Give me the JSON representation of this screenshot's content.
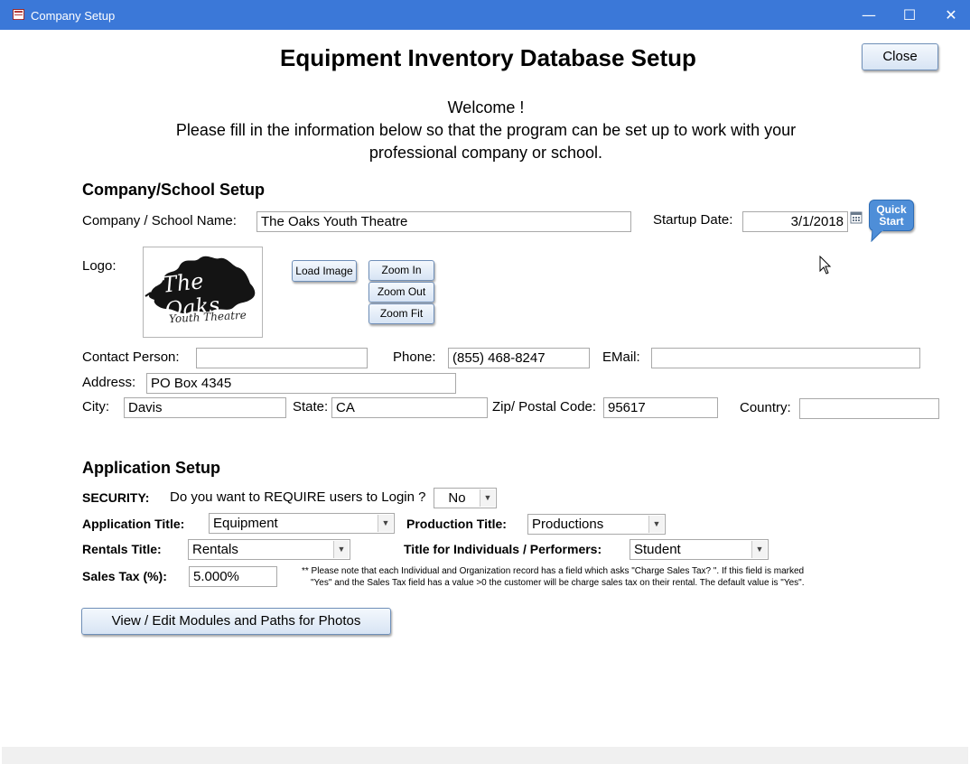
{
  "window": {
    "title": "Company Setup",
    "minimize": "—",
    "maximize": "☐",
    "close": "✕"
  },
  "header": {
    "title": "Equipment Inventory Database Setup",
    "close_button": "Close",
    "welcome_line1": "Welcome !",
    "welcome_line2": "Please fill in the information below so that the program can be set up to work with your",
    "welcome_line3": "professional company or school."
  },
  "company": {
    "section_title": "Company/School Setup",
    "name_label": "Company / School Name:",
    "name_value": "The Oaks Youth Theatre",
    "startup_label": "Startup Date:",
    "startup_value": "3/1/2018",
    "quick_start_line1": "Quick",
    "quick_start_line2": "Start",
    "logo_label": "Logo:",
    "logo_text_main": "The Oaks",
    "logo_text_sub": "Youth Theatre",
    "load_image": "Load Image",
    "zoom_in": "Zoom In",
    "zoom_out": "Zoom Out",
    "zoom_fit": "Zoom Fit",
    "contact_label": "Contact Person:",
    "contact_value": "",
    "phone_label": "Phone:",
    "phone_value": "(855) 468-8247",
    "email_label": "EMail:",
    "email_value": "",
    "address_label": "Address:",
    "address_value": "PO Box 4345",
    "city_label": "City:",
    "city_value": "Davis",
    "state_label": "State:",
    "state_value": "CA",
    "zip_label": "Zip/ Postal Code:",
    "zip_value": "95617",
    "country_label": "Country:",
    "country_value": ""
  },
  "application": {
    "section_title": "Application Setup",
    "security_label": "SECURITY:",
    "security_question": "Do you want to REQUIRE users to Login ?",
    "security_value": "No",
    "app_title_label": "Application Title:",
    "app_title_value": "Equipment",
    "production_title_label": "Production Title:",
    "production_title_value": "Productions",
    "rentals_title_label": "Rentals Title:",
    "rentals_title_value": "Rentals",
    "individuals_title_label": "Title for Individuals / Performers:",
    "individuals_title_value": "Student",
    "sales_tax_label": "Sales Tax (%):",
    "sales_tax_value": "5.000%",
    "note_line1": "** Please note that each Individual and Organization record has a field which asks \"Charge Sales Tax? \".  If this field is marked",
    "note_line2": "\"Yes\" and the Sales Tax field has a value >0 the customer will be charge sales tax on their rental.  The default value is \"Yes\".",
    "modules_button": "View / Edit Modules and Paths for Photos"
  },
  "icons": {
    "app": "form-icon",
    "calendar": "calendar-icon",
    "cursor": "mouse-pointer-icon",
    "dropdown": "chevron-down-icon"
  }
}
